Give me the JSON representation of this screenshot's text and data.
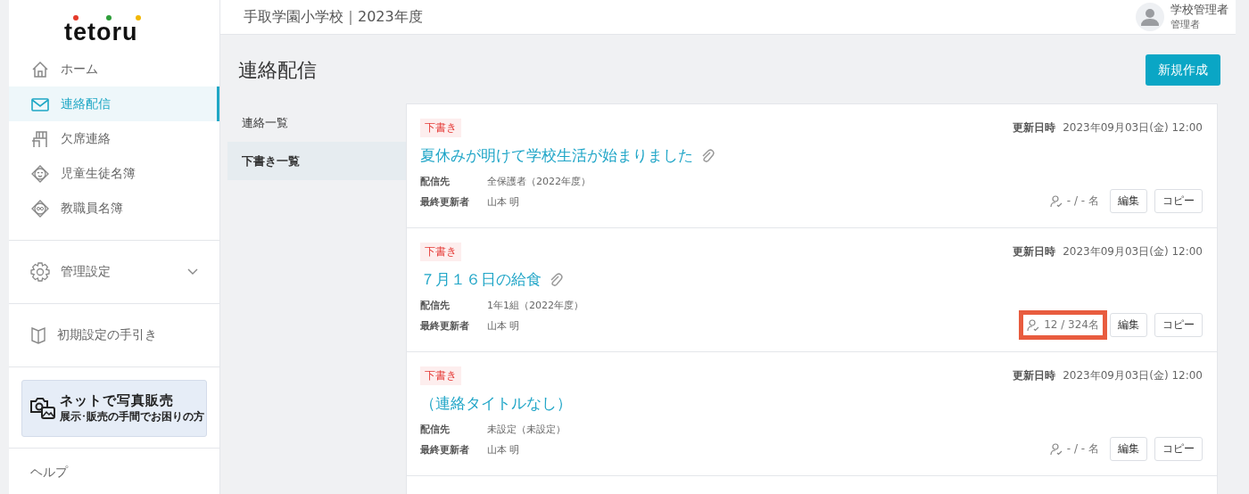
{
  "logo": "tetoru",
  "sidebar": {
    "items": [
      {
        "label": "ホーム",
        "selected": false
      },
      {
        "label": "連絡配信",
        "selected": true
      },
      {
        "label": "欠席連絡",
        "selected": false
      },
      {
        "label": "児童生徒名簿",
        "selected": false
      },
      {
        "label": "教職員名簿",
        "selected": false
      }
    ],
    "settings": {
      "label": "管理設定",
      "expanded": false
    },
    "guide": "初期設定の手引き",
    "banner": {
      "title": "ネットで写真販売",
      "subtitle": "展示･販売の手間でお困りの方"
    },
    "help": "ヘルプ"
  },
  "header": {
    "title": "手取学園小学校｜2023年度",
    "user": {
      "name": "学校管理者",
      "role": "管理者"
    }
  },
  "page": {
    "title": "連絡配信",
    "new_button": "新規作成"
  },
  "subnav": [
    {
      "label": "連絡一覧",
      "selected": false
    },
    {
      "label": "下書き一覧",
      "selected": true
    }
  ],
  "messages": [
    {
      "status": "下書き",
      "updated_label": "更新日時",
      "updated": "2023年09月03日(金) 12:00",
      "title": "夏休みが明けて学校生活が始まりました",
      "attachment": true,
      "to_label": "配信先",
      "to": "全保護者（2022年度）",
      "editor_label": "最終更新者",
      "editor": "山本 明",
      "count": "- / - 名",
      "highlighted": false,
      "edit": "編集",
      "copy": "コピー"
    },
    {
      "status": "下書き",
      "updated_label": "更新日時",
      "updated": "2023年09月03日(金) 12:00",
      "title": "７月１６日の給食",
      "attachment": true,
      "to_label": "配信先",
      "to": "1年1組（2022年度）",
      "editor_label": "最終更新者",
      "editor": "山本 明",
      "count": "12 / 324名",
      "highlighted": true,
      "edit": "編集",
      "copy": "コピー"
    },
    {
      "status": "下書き",
      "updated_label": "更新日時",
      "updated": "2023年09月03日(金) 12:00",
      "title": "（連絡タイトルなし）",
      "attachment": false,
      "to_label": "配信先",
      "to": "未設定（未設定）",
      "editor_label": "最終更新者",
      "editor": "山本 明",
      "count": "- / - 名",
      "highlighted": false,
      "edit": "編集",
      "copy": "コピー"
    }
  ]
}
